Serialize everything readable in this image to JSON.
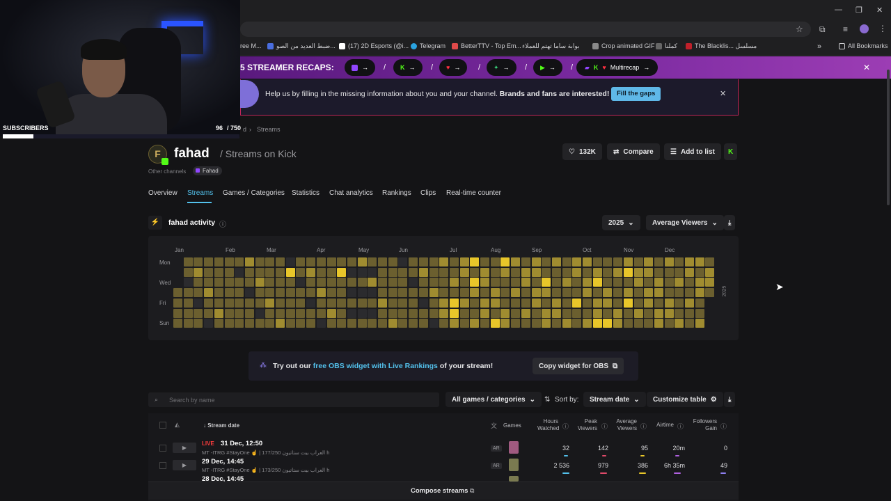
{
  "browser": {
    "bookmarks": [
      {
        "label": "ree M...",
        "color": "#333"
      },
      {
        "label": "ضبط العديد من الصو...",
        "color": "#4a6ee0"
      },
      {
        "label": "(17) 2D Esports (@i...",
        "color": "#ffffff"
      },
      {
        "label": "Telegram",
        "color": "#2aa3e0"
      },
      {
        "label": "BetterTTV - Top Em...",
        "color": "#e04a4a"
      },
      {
        "label": "بوابة ساما تهتم للعملاء",
        "color": "#2a2a2a"
      },
      {
        "label": "Crop animated GIF",
        "color": "#8a8a8a"
      },
      {
        "label": "كملنا",
        "color": "#666"
      },
      {
        "label": "The Blacklis... مسلسل",
        "color": "#c0202a"
      }
    ],
    "all_bookmarks": "All Bookmarks",
    "more_bookmarks": "»"
  },
  "overlay": {
    "subscribers_label": "SUBSCRIBERS",
    "subscribers_count": "96",
    "subscribers_goal": "/ 750",
    "subscribers_progress": 0.128
  },
  "recap": {
    "title": "5 STREAMER RECAPS:",
    "pills": [
      "twitch-icon",
      "kick-icon",
      "youtube-icon",
      "kick-green-icon",
      "rumble-icon"
    ],
    "multirecap": "Multirecap"
  },
  "notice": {
    "text": "Help us by filling in the missing information about you and your channel.",
    "bold": "Brands and fans are interested!",
    "button": "Fill the gaps"
  },
  "breadcrumb": {
    "prev": "d",
    "current": "Streams"
  },
  "channel": {
    "name": "fahad",
    "subtitle": "/ Streams on Kick",
    "other_channels_label": "Other channels",
    "other_channel": "Fahad",
    "likes": "132K",
    "compare": "Compare",
    "add_to_list": "Add to list"
  },
  "tabs": [
    {
      "label": "Overview",
      "active": false
    },
    {
      "label": "Streams",
      "active": true
    },
    {
      "label": "Games / Categories",
      "active": false
    },
    {
      "label": "Statistics",
      "active": false
    },
    {
      "label": "Chat analytics",
      "active": false
    },
    {
      "label": "Rankings",
      "active": false
    },
    {
      "label": "Clips",
      "active": false
    },
    {
      "label": "Real-time counter",
      "active": false
    }
  ],
  "activity": {
    "title": "fahad activity",
    "year": "2025",
    "metric": "Average Viewers",
    "months": [
      "Jan",
      "Feb",
      "Mar",
      "Apr",
      "May",
      "Jun",
      "Jul",
      "Aug",
      "Sep",
      "Oct",
      "Nov",
      "Dec"
    ],
    "days": [
      "Mon",
      "Wed",
      "Fri",
      "Sun"
    ],
    "year_label": "2025",
    "colors": {
      "empty": "#2b2b2e",
      "low": "#6b5f2f",
      "mid": "#a08c30",
      "high": "#e8c62a"
    }
  },
  "obs": {
    "lead": "Try out our",
    "link": "free OBS widget with Live Rankings",
    "tail": "of your stream!",
    "button": "Copy widget for OBS"
  },
  "table_controls": {
    "search_placeholder": "Search by name",
    "filter": "All games / categories",
    "sort_label": "Sort by:",
    "sort_value": "Stream date",
    "customize": "Customize table"
  },
  "table": {
    "headers": {
      "date": "Stream date",
      "games": "Games",
      "hours_watched": [
        "Hours",
        "Watched"
      ],
      "peak": [
        "Peak",
        "Viewers"
      ],
      "avg": [
        "Average",
        "Viewers"
      ],
      "airtime": "Airtime",
      "followers": [
        "Followers",
        "Gain"
      ]
    },
    "rows": [
      {
        "live": "LIVE",
        "date": "31 Dec, 12:50",
        "title": "MT -ITRG #StayOne ☝️ | العراب بيت ستاتيون 177/250 h",
        "lang": "AR",
        "hours": "32",
        "peak": "142",
        "avg": "95",
        "airtime": "20m",
        "followers": "0"
      },
      {
        "live": "",
        "date": "29 Dec, 14:45",
        "title": "MT -ITRG #StayOne ☝️ | العراب بيت ستاتيون 173/250 h",
        "lang": "AR",
        "hours": "2 536",
        "peak": "979",
        "avg": "386",
        "airtime": "6h 35m",
        "followers": "49"
      },
      {
        "live": "",
        "date": "28 Dec, 14:45",
        "title": "",
        "lang": "",
        "hours": "",
        "peak": "",
        "avg": "",
        "airtime": "",
        "followers": ""
      }
    ],
    "compose": "Compose streams"
  }
}
